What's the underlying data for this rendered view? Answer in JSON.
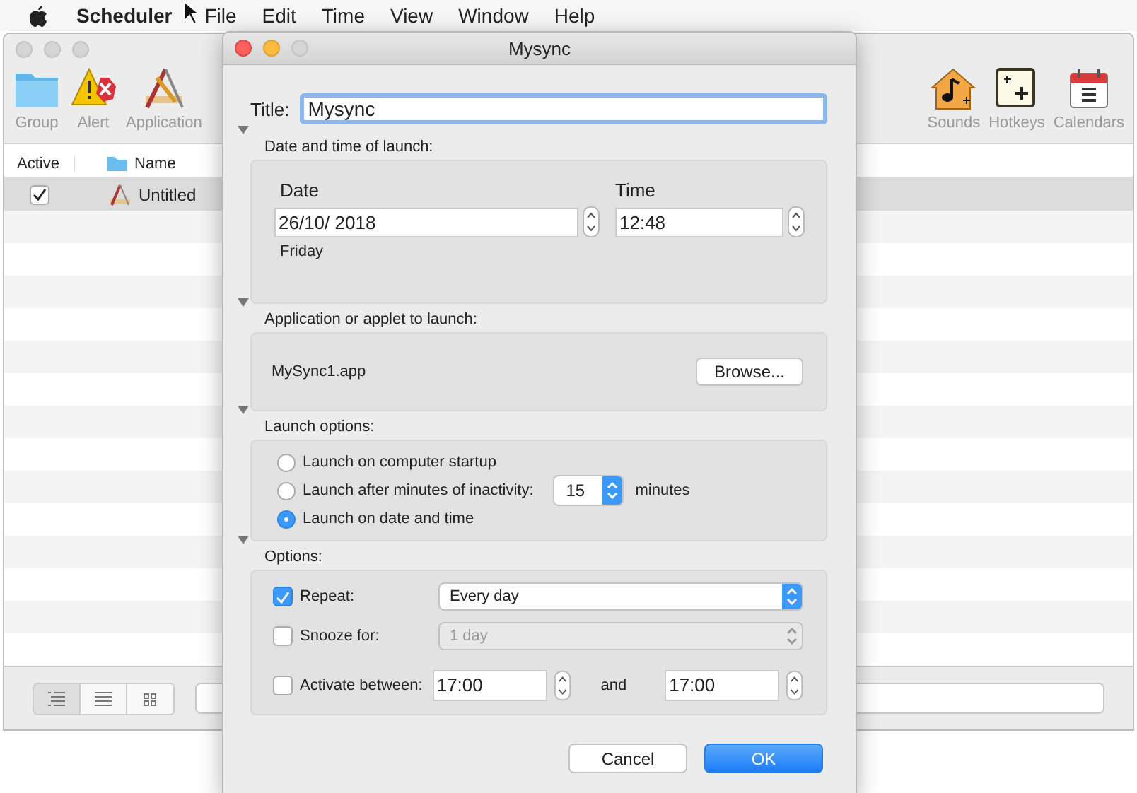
{
  "menu_bar": {
    "app": "Scheduler",
    "items": [
      "File",
      "Edit",
      "Time",
      "View",
      "Window",
      "Help"
    ]
  },
  "main_window": {
    "toolbar_left": [
      {
        "kind": "folder",
        "label": "Group"
      },
      {
        "kind": "alert",
        "label": "Alert"
      },
      {
        "kind": "application",
        "label": "Application"
      }
    ],
    "toolbar_right": [
      {
        "kind": "sounds",
        "label": "Sounds"
      },
      {
        "kind": "hotkeys",
        "label": "Hotkeys"
      },
      {
        "kind": "calendar",
        "label": "Calendars"
      }
    ],
    "columns": [
      "Active",
      "Name"
    ],
    "rows": [
      {
        "checked": true,
        "name": "Untitled",
        "selected": true
      }
    ],
    "view_buttons": [
      {
        "kind": "outline",
        "selected": true
      },
      {
        "kind": "list",
        "selected": false
      },
      {
        "kind": "grid",
        "selected": false
      }
    ]
  },
  "dialog": {
    "title": "Mysync",
    "title_label": "Title:",
    "title_value": "Mysync",
    "date_time": {
      "label": "Date and time of launch:",
      "expanded": true,
      "date_label": "Date",
      "time_label": "Time",
      "date_value": "26/10/ 2018",
      "time_value": "12:48",
      "weekday": "Friday"
    },
    "application": {
      "label": "Application or applet to launch:",
      "expanded": true,
      "file": "MySync1.app",
      "button": "Browse..."
    },
    "launch_options": {
      "label": "Launch options:",
      "expanded": true,
      "choices": [
        {
          "kind": "plain",
          "label": "Launch on computer startup",
          "selected": false
        },
        {
          "kind": "minutes",
          "label": "Launch after minutes of inactivity:",
          "selected": false,
          "value": "15",
          "unit": "minutes"
        },
        {
          "kind": "plain",
          "label": "Launch on date and time",
          "selected": true
        }
      ]
    },
    "options": {
      "label": "Options:",
      "expanded": true,
      "rows": [
        {
          "kind": "select",
          "label": "Repeat:",
          "checked": true,
          "value": "Every day",
          "disabled": false
        },
        {
          "kind": "select",
          "label": "Snooze for:",
          "checked": false,
          "value": "1 day",
          "disabled": true
        },
        {
          "kind": "range",
          "label": "Activate between:",
          "checked": false,
          "from": "17:00",
          "and_label": "and",
          "to": "17:00"
        }
      ]
    },
    "buttons": [
      {
        "label": "Cancel",
        "default": false
      },
      {
        "label": "OK",
        "default": true
      }
    ]
  }
}
